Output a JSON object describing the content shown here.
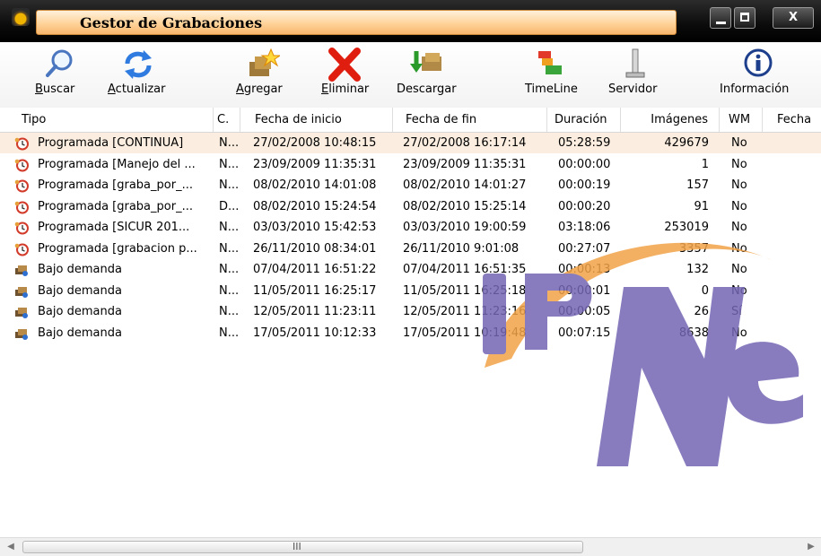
{
  "window": {
    "title": "Gestor de Grabaciones",
    "controls": {
      "minimize": "minimize",
      "maximize": "maximize",
      "close": "X"
    }
  },
  "toolbar": {
    "buttons": [
      {
        "id": "buscar",
        "accel": "B",
        "rest": "uscar",
        "icon": "magnifier-icon"
      },
      {
        "id": "actualizar",
        "accel": "A",
        "rest": "ctualizar",
        "icon": "refresh-arrows-icon"
      },
      {
        "id": "agregar",
        "accel": "A",
        "rest": "gregar",
        "icon": "add-recording-icon"
      },
      {
        "id": "eliminar",
        "accel": "E",
        "rest": "liminar",
        "icon": "red-x-icon"
      },
      {
        "id": "descargar",
        "accel": "",
        "rest": "Descargar",
        "icon": "download-icon"
      },
      {
        "id": "timeline",
        "accel": "",
        "rest": "TimeLine",
        "icon": "timeline-icon"
      },
      {
        "id": "servidor",
        "accel": "",
        "rest": "Servidor",
        "icon": "server-icon"
      },
      {
        "id": "informacion",
        "accel": "",
        "rest": "Información",
        "icon": "info-icon"
      }
    ]
  },
  "table": {
    "columns": [
      "Tipo",
      "C.",
      "Fecha de inicio",
      "Fecha de fin",
      "Duración",
      "Imágenes",
      "WM",
      "Fecha"
    ],
    "rows": [
      {
        "tipo": "Programada [CONTINUA]",
        "c": "N...",
        "inicio": "27/02/2008 10:48:15",
        "fin": "27/02/2008 16:17:14",
        "duracion": "05:28:59",
        "imagenes": "429679",
        "wm": "No",
        "icon": "scheduled-clock-icon",
        "selected": true
      },
      {
        "tipo": "Programada [Manejo del ...",
        "c": "N...",
        "inicio": "23/09/2009 11:35:31",
        "fin": "23/09/2009 11:35:31",
        "duracion": "00:00:00",
        "imagenes": "1",
        "wm": "No",
        "icon": "scheduled-clock-icon"
      },
      {
        "tipo": "Programada [graba_por_...",
        "c": "N...",
        "inicio": "08/02/2010 14:01:08",
        "fin": "08/02/2010 14:01:27",
        "duracion": "00:00:19",
        "imagenes": "157",
        "wm": "No",
        "icon": "scheduled-clock-icon"
      },
      {
        "tipo": "Programada [graba_por_...",
        "c": "D...",
        "inicio": "08/02/2010 15:24:54",
        "fin": "08/02/2010 15:25:14",
        "duracion": "00:00:20",
        "imagenes": "91",
        "wm": "No",
        "icon": "scheduled-clock-icon"
      },
      {
        "tipo": "Programada [SICUR 201...",
        "c": "N...",
        "inicio": "03/03/2010 15:42:53",
        "fin": "03/03/2010 19:00:59",
        "duracion": "03:18:06",
        "imagenes": "253019",
        "wm": "No",
        "icon": "scheduled-clock-icon"
      },
      {
        "tipo": "Programada [grabacion p...",
        "c": "N...",
        "inicio": "26/11/2010 08:34:01",
        "fin": "26/11/2010 9:01:08",
        "duracion": "00:27:07",
        "imagenes": "3357",
        "wm": "No",
        "icon": "scheduled-clock-icon"
      },
      {
        "tipo": "Bajo demanda",
        "c": "N...",
        "inicio": "07/04/2011 16:51:22",
        "fin": "07/04/2011 16:51:35",
        "duracion": "00:00:13",
        "imagenes": "132",
        "wm": "No",
        "icon": "on-demand-icon"
      },
      {
        "tipo": "Bajo demanda",
        "c": "N...",
        "inicio": "11/05/2011 16:25:17",
        "fin": "11/05/2011 16:25:18",
        "duracion": "00:00:01",
        "imagenes": "0",
        "wm": "No",
        "icon": "on-demand-icon"
      },
      {
        "tipo": "Bajo demanda",
        "c": "N...",
        "inicio": "12/05/2011 11:23:11",
        "fin": "12/05/2011 11:23:16",
        "duracion": "00:00:05",
        "imagenes": "26",
        "wm": "Sí",
        "icon": "on-demand-icon"
      },
      {
        "tipo": "Bajo demanda",
        "c": "N...",
        "inicio": "17/05/2011 10:12:33",
        "fin": "17/05/2011 10:19:48",
        "duracion": "00:07:15",
        "imagenes": "8638",
        "wm": "No",
        "icon": "on-demand-icon"
      }
    ]
  },
  "watermark": {
    "text": "IP NET",
    "colors": {
      "purple": "#7466b4",
      "orange": "#f2a347"
    }
  },
  "scrollbar": {
    "grip": "III"
  }
}
